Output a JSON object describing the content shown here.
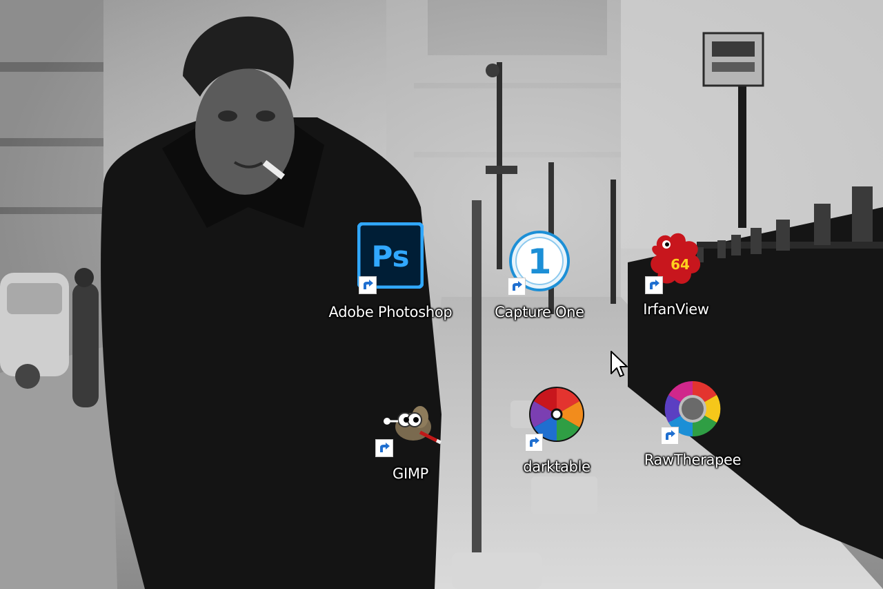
{
  "desktop": {
    "icons": [
      {
        "label": "Adobe Photoshop",
        "icon": "photoshop-icon",
        "glyph_text": "Ps",
        "color": "#31a8ff"
      },
      {
        "label": "Capture One",
        "icon": "capture-one-icon",
        "glyph_text": "1",
        "color": "#1c8fd6"
      },
      {
        "label": "IrfanView",
        "icon": "irfanview-icon",
        "glyph_text": "64",
        "color": "#c8161d"
      },
      {
        "label": "GIMP",
        "icon": "gimp-icon",
        "color": "#7a6a4f"
      },
      {
        "label": "darktable",
        "icon": "darktable-icon"
      },
      {
        "label": "RawTherapee",
        "icon": "rawtherapee-icon"
      }
    ],
    "shortcut_overlay": "shortcut-arrow-icon",
    "cursor": "mouse-pointer-icon"
  }
}
